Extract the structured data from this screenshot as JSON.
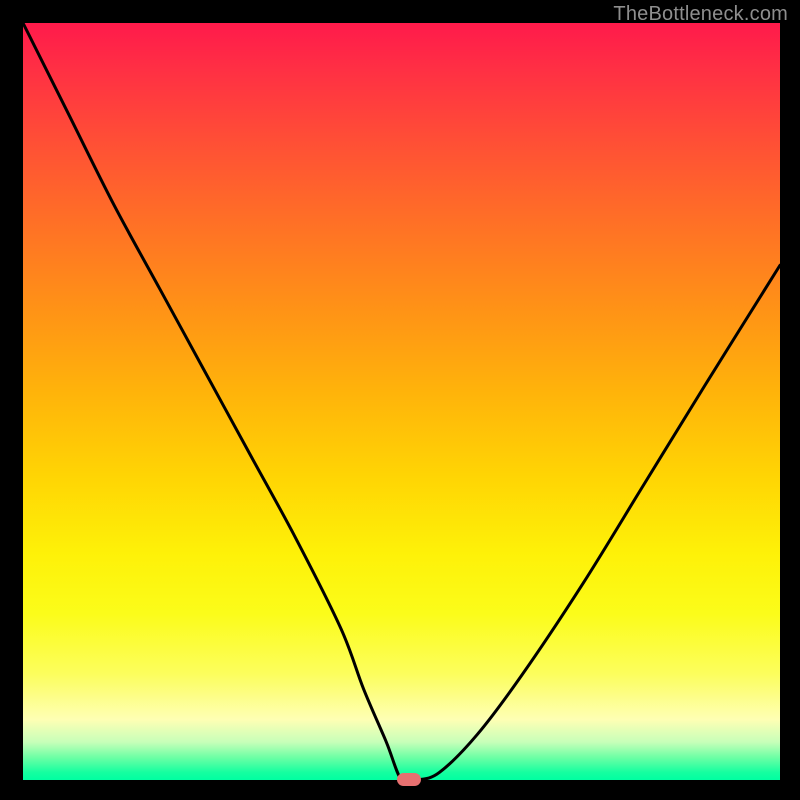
{
  "watermark": "TheBottleneck.com",
  "chart_data": {
    "type": "line",
    "title": "",
    "xlabel": "",
    "ylabel": "",
    "xlim": [
      0,
      100
    ],
    "ylim": [
      0,
      100
    ],
    "grid": false,
    "legend": false,
    "series": [
      {
        "name": "curve",
        "x": [
          0,
          6,
          12,
          18,
          24,
          30,
          36,
          42,
          45,
          48,
          50,
          52,
          55,
          60,
          66,
          74,
          82,
          90,
          100
        ],
        "y": [
          100,
          88,
          76,
          65,
          54,
          43,
          32,
          20,
          12,
          5,
          0,
          0,
          1,
          6,
          14,
          26,
          39,
          52,
          68
        ]
      }
    ],
    "marker": {
      "x": 51,
      "y": 0,
      "color": "#e77070"
    },
    "background_gradient": {
      "type": "vertical",
      "stops": [
        {
          "pos": 0.0,
          "color": "#ff1a4b"
        },
        {
          "pos": 0.35,
          "color": "#ff8a1a"
        },
        {
          "pos": 0.7,
          "color": "#fff010"
        },
        {
          "pos": 0.92,
          "color": "#fdffb0"
        },
        {
          "pos": 1.0,
          "color": "#00ffa1"
        }
      ]
    }
  }
}
